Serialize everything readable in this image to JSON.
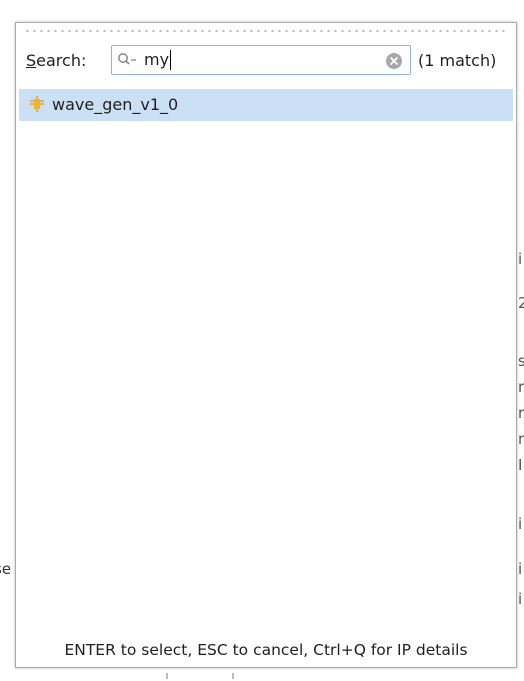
{
  "popup": {
    "search_label_mnemonic": "S",
    "search_label_rest": "earch:",
    "search_value": "my",
    "match_count": "(1 match)",
    "results": [
      {
        "label": "wave_gen_v1_0",
        "icon": "ip-core-icon",
        "selected": true
      }
    ],
    "footer_hint": "ENTER to select, ESC to cancel, Ctrl+Q for IP details"
  },
  "background": {
    "left_fragment": "se",
    "right_fragments": [
      "i",
      "2",
      "s",
      "r",
      "r",
      "r",
      "I",
      "i",
      "i",
      "i"
    ]
  },
  "colors": {
    "selection": "#cce0f5",
    "ip_icon": "#f0b429",
    "border": "#a9a9a9"
  }
}
